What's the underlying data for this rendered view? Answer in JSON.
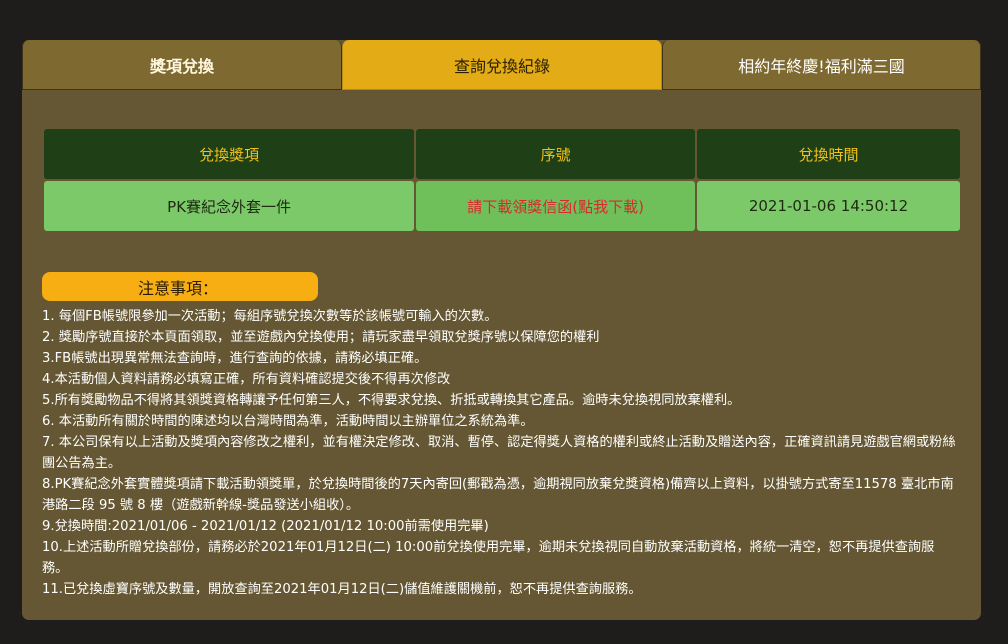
{
  "tabs": [
    {
      "label": "獎項兌換"
    },
    {
      "label": "查詢兌換紀錄"
    },
    {
      "label": "相約年終慶!福利滿三國"
    }
  ],
  "table": {
    "headers": [
      "兌換獎項",
      "序號",
      "兌換時間"
    ],
    "row": {
      "prize": "PK賽紀念外套一件",
      "serial": "請下載領獎信函(點我下載)",
      "time": "2021-01-06 14:50:12"
    }
  },
  "notice": {
    "title": "注意事項：",
    "items": [
      "1. 每個FB帳號限參加一次活動；每組序號兌換次數等於該帳號可輸入的次數。",
      "2. 獎勵序號直接於本頁面領取，並至遊戲內兌換使用；請玩家盡早領取兌獎序號以保障您的權利",
      "3.FB帳號出現異常無法查詢時，進行查詢的依據，請務必填正確。",
      "4.本活動個人資料請務必填寫正確，所有資料確認提交後不得再次修改",
      "5.所有獎勵物品不得將其領獎資格轉讓予任何第三人，不得要求兌換、折抵或轉換其它產品。逾時未兌換視同放棄權利。",
      "6. 本活動所有關於時間的陳述均以台灣時間為準，活動時間以主辦單位之系統為準。",
      "7. 本公司保有以上活動及獎項內容修改之權利，並有權決定修改、取消、暫停、認定得獎人資格的權利或終止活動及贈送內容，正確資訊請見遊戲官網或粉絲團公告為主。",
      "8.PK賽紀念外套實體獎項請下載活動領獎單，於兌換時間後的7天內寄回(郵戳為憑，逾期視同放棄兌獎資格)備齊以上資料，以掛號方式寄至11578 臺北市南港路二段 95 號 8 樓（遊戲新幹線-獎品發送小組收）。",
      "9.兌換時間:2021/01/06 - 2021/01/12 (2021/01/12 10:00前需使用完畢)",
      "10.上述活動所贈兌換部份，請務必於2021年01月12日(二) 10:00前兌換使用完畢，逾期未兌換視同自動放棄活動資格，將統一清空，恕不再提供查詢服務。",
      "11.已兌換虛寶序號及數量，開放查詢至2021年01月12日(二)儲值維護關機前，恕不再提供查詢服務。"
    ]
  }
}
